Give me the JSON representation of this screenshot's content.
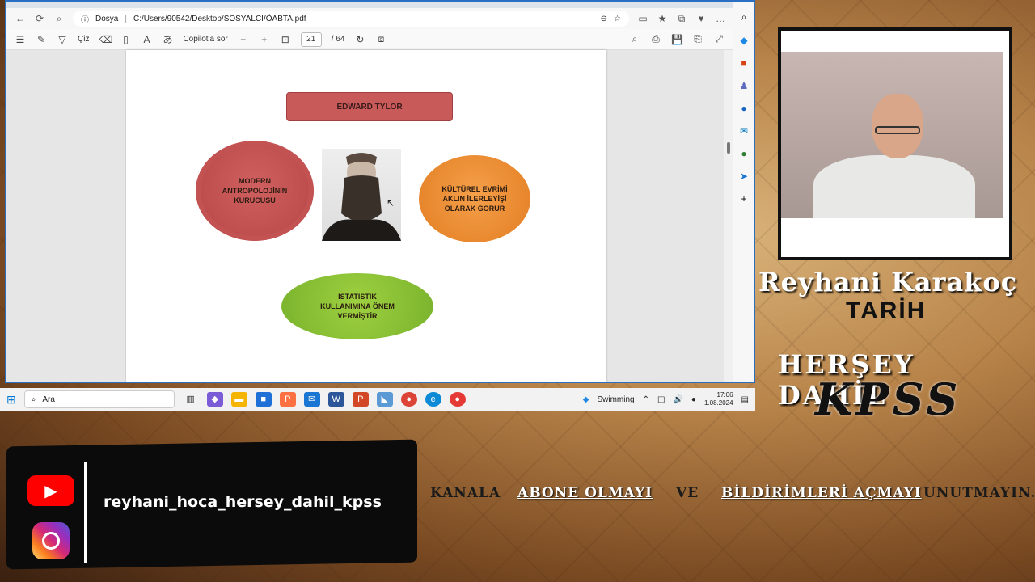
{
  "browser": {
    "address_label": "Dosya",
    "url": "C:/Users/90542/Desktop/SOSYALCI/ÖABTA.pdf"
  },
  "pdf_toolbar": {
    "draw_label": "Çiz",
    "copilot_label": "Copilot'a sor",
    "current_page": "21",
    "total_pages": "/ 64"
  },
  "slide": {
    "title": "EDWARD TYLOR",
    "left_cloud": "MODERN ANTROPOLOJİNİN KURUCUSU",
    "right_cloud": "KÜLTÜREL EVRİMİ AKLIN İLERLEYİŞİ OLARAK GÖRÜR",
    "bottom_cloud": "İSTATİSTİK KULLANIMINA ÖNEM VERMİŞTİR"
  },
  "taskbar": {
    "search_placeholder": "Ara",
    "weather": "Swimming",
    "time": "17:06",
    "date": "1.08.2024"
  },
  "overlay": {
    "name": "Reyhani Karakoç",
    "subject": "TARİH",
    "tagline": "HERŞEY DAHİL",
    "kpss": "KPSS"
  },
  "social": {
    "handle": "reyhani_hoca_hersey_dahil_kpss",
    "cta1": "KANALA",
    "cta2": "ABONE OLMAYI",
    "cta3": "VE",
    "cta4": "BİLDİRİMLERİ AÇMAYI",
    "cta5": "UNUTMAYIN."
  }
}
